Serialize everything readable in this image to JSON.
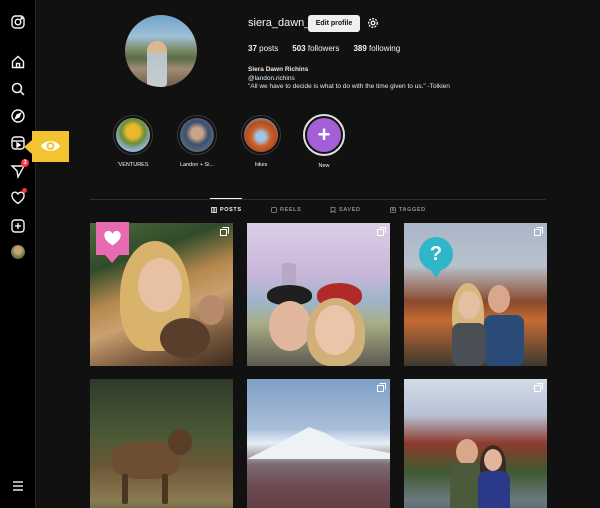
{
  "sidebar": {
    "items": [
      {
        "name": "instagram-icon"
      },
      {
        "name": "home-icon"
      },
      {
        "name": "search-icon"
      },
      {
        "name": "explore-icon"
      },
      {
        "name": "reels-icon"
      },
      {
        "name": "messages-icon",
        "badge": "3"
      },
      {
        "name": "notifications-icon"
      },
      {
        "name": "create-icon"
      },
      {
        "name": "profile-avatar"
      },
      {
        "name": "more-menu-icon"
      }
    ]
  },
  "profile": {
    "username": "siera_dawn_",
    "edit_label": "Edit profile",
    "stats": {
      "posts_count": "37",
      "posts_label": "posts",
      "followers_count": "503",
      "followers_label": "followers",
      "following_count": "389",
      "following_label": "following"
    },
    "bio": {
      "name": "Siera Dawn Richins",
      "handle": "@landon.richins",
      "quote": "\"All we have to decide is what to do with the time given to us.\" -Tolkien"
    }
  },
  "highlights": [
    {
      "label": "'VENTURES"
    },
    {
      "label": "Landon + Si..."
    },
    {
      "label": "hikes"
    },
    {
      "label": "New"
    }
  ],
  "tabs": [
    {
      "label": "POSTS",
      "active": true
    },
    {
      "label": "REELS",
      "active": false
    },
    {
      "label": "SAVED",
      "active": false
    },
    {
      "label": "TAGGED",
      "active": false
    }
  ],
  "callouts": {
    "question_mark": "?"
  },
  "colors": {
    "eye_callout": "#f4c430",
    "heart_callout": "#e86ab0",
    "question_callout": "#2fb6c9",
    "new_highlight": "#a35fd6",
    "badge": "#ff3040"
  }
}
